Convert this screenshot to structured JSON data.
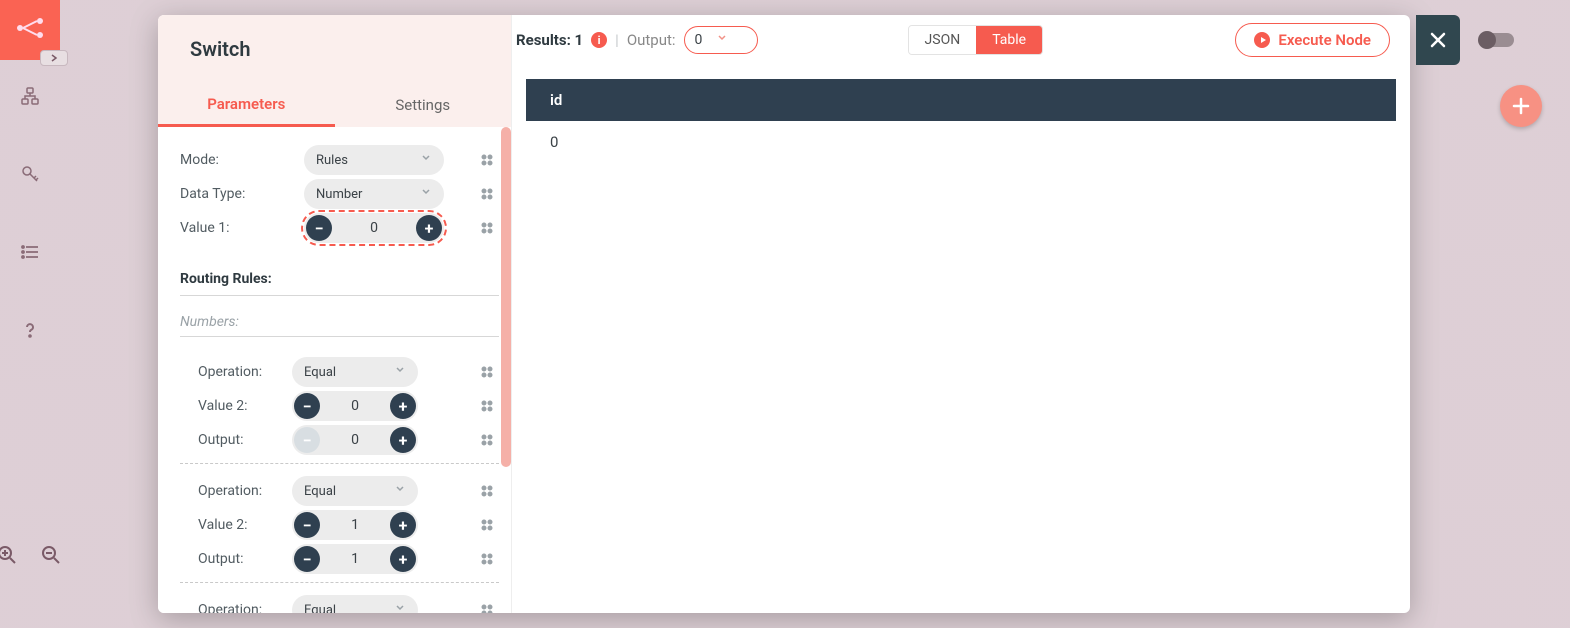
{
  "background_sidebar": {
    "items": [
      "workflow-icon",
      "hierarchy-icon",
      "key-icon",
      "list-icon",
      "help-icon"
    ]
  },
  "modal": {
    "title": "Switch",
    "tabs": {
      "parameters": "Parameters",
      "settings": "Settings",
      "active": "parameters"
    },
    "fields": {
      "mode_label": "Mode:",
      "mode_value": "Rules",
      "datatype_label": "Data Type:",
      "datatype_value": "Number",
      "value1_label": "Value 1:",
      "value1_value": "0"
    },
    "routing_title": "Routing Rules:",
    "numbers_title": "Numbers:",
    "rules": [
      {
        "operation_label": "Operation:",
        "operation_value": "Equal",
        "value2_label": "Value 2:",
        "value2_value": "0",
        "output_label": "Output:",
        "output_value": "0",
        "output_dec_disabled": true
      },
      {
        "operation_label": "Operation:",
        "operation_value": "Equal",
        "value2_label": "Value 2:",
        "value2_value": "1",
        "output_label": "Output:",
        "output_value": "1",
        "output_dec_disabled": false
      },
      {
        "operation_label": "Operation:",
        "operation_value": "Equal"
      }
    ]
  },
  "right": {
    "results_prefix": "Results:",
    "results_count": "1",
    "output_label": "Output:",
    "output_value": "0",
    "view": {
      "json": "JSON",
      "table": "Table",
      "active": "table"
    },
    "execute_label": "Execute Node",
    "table": {
      "columns": [
        "id"
      ],
      "rows": [
        [
          "0"
        ]
      ]
    }
  },
  "glyphs": {
    "minus": "−",
    "plus": "+"
  }
}
